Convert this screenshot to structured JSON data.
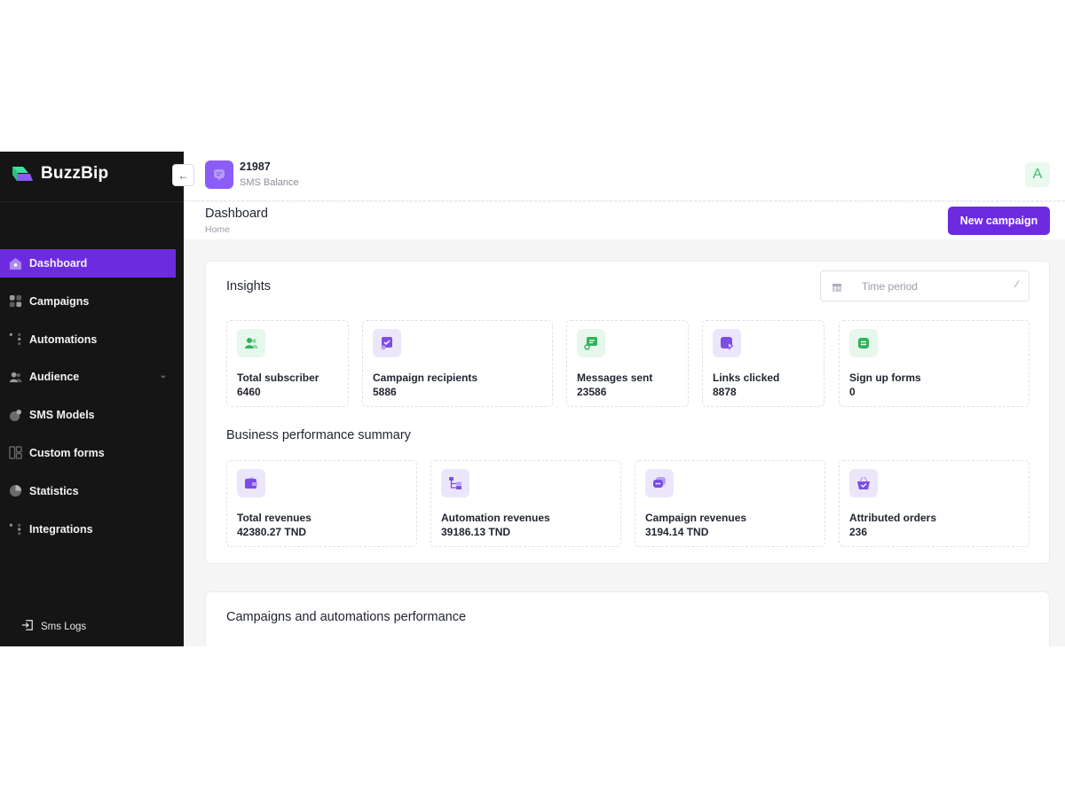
{
  "app": {
    "name": "BuzzBip"
  },
  "sidebar": {
    "items": [
      {
        "label": "Dashboard",
        "icon": "home-icon",
        "active": true
      },
      {
        "label": "Campaigns",
        "icon": "grid-icon"
      },
      {
        "label": "Automations",
        "icon": "flow-icon"
      },
      {
        "label": "Audience",
        "icon": "users-icon",
        "has_chevron": true
      },
      {
        "label": "SMS Models",
        "icon": "template-icon"
      },
      {
        "label": "Custom forms",
        "icon": "form-icon"
      },
      {
        "label": "Statistics",
        "icon": "pie-chart-icon"
      },
      {
        "label": "Integrations",
        "icon": "plug-icon"
      }
    ],
    "footer_link": "Sms Logs"
  },
  "topbar": {
    "sms_balance_value": "21987",
    "sms_balance_label": "SMS Balance",
    "avatar_letter": "A"
  },
  "pagehead": {
    "title": "Dashboard",
    "breadcrumb": "Home",
    "new_campaign_label": "New campaign"
  },
  "insights": {
    "title": "Insights",
    "time_period_placeholder": "Time period",
    "stats": [
      {
        "label": "Total subscriber",
        "value": "6460",
        "icon": "users-icon",
        "color": "green"
      },
      {
        "label": "Campaign recipients",
        "value": "5886",
        "icon": "campaign-icon",
        "color": "purple"
      },
      {
        "label": "Messages sent",
        "value": "23586",
        "icon": "message-sent-icon",
        "color": "green"
      },
      {
        "label": "Links clicked",
        "value": "8878",
        "icon": "link-click-icon",
        "color": "purple"
      },
      {
        "label": "Sign up forms",
        "value": "0",
        "icon": "form-icon",
        "color": "green"
      }
    ],
    "business_title": "Business performance summary",
    "business": [
      {
        "label": "Total revenues",
        "value": "42380.27 TND",
        "icon": "wallet-icon"
      },
      {
        "label": "Automation revenues",
        "value": "39186.13 TND",
        "icon": "automation-icon"
      },
      {
        "label": "Campaign revenues",
        "value": "3194.14 TND",
        "icon": "chat-icon"
      },
      {
        "label": "Attributed orders",
        "value": "236",
        "icon": "basket-icon"
      }
    ]
  },
  "performance": {
    "title": "Campaigns and automations performance"
  },
  "colors": {
    "accent": "#6d2be0",
    "sidebar_bg": "#151515",
    "green_icon": "#2fb35a",
    "purple_icon": "#7c4ee4"
  }
}
